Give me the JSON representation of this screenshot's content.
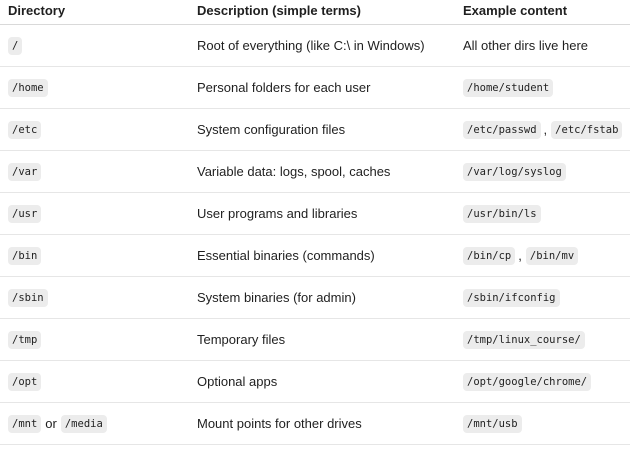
{
  "headers": {
    "directory": "Directory",
    "description": "Description (simple terms)",
    "example": "Example content"
  },
  "rows": [
    {
      "dirs": [
        "/"
      ],
      "dir_sep": "",
      "description": "Root of everything (like C:\\ in Windows)",
      "example_text": "All other dirs live here",
      "examples": []
    },
    {
      "dirs": [
        "/home"
      ],
      "dir_sep": "",
      "description": "Personal folders for each user",
      "example_text": "",
      "examples": [
        "/home/student"
      ]
    },
    {
      "dirs": [
        "/etc"
      ],
      "dir_sep": "",
      "description": "System configuration files",
      "example_text": "",
      "examples": [
        "/etc/passwd",
        "/etc/fstab"
      ]
    },
    {
      "dirs": [
        "/var"
      ],
      "dir_sep": "",
      "description": "Variable data: logs, spool, caches",
      "example_text": "",
      "examples": [
        "/var/log/syslog"
      ]
    },
    {
      "dirs": [
        "/usr"
      ],
      "dir_sep": "",
      "description": "User programs and libraries",
      "example_text": "",
      "examples": [
        "/usr/bin/ls"
      ]
    },
    {
      "dirs": [
        "/bin"
      ],
      "dir_sep": "",
      "description": "Essential binaries (commands)",
      "example_text": "",
      "examples": [
        "/bin/cp",
        "/bin/mv"
      ]
    },
    {
      "dirs": [
        "/sbin"
      ],
      "dir_sep": "",
      "description": "System binaries (for admin)",
      "example_text": "",
      "examples": [
        "/sbin/ifconfig"
      ]
    },
    {
      "dirs": [
        "/tmp"
      ],
      "dir_sep": "",
      "description": "Temporary files",
      "example_text": "",
      "examples": [
        "/tmp/linux_course/"
      ]
    },
    {
      "dirs": [
        "/opt"
      ],
      "dir_sep": "",
      "description": "Optional apps",
      "example_text": "",
      "examples": [
        "/opt/google/chrome/"
      ]
    },
    {
      "dirs": [
        "/mnt",
        "/media"
      ],
      "dir_sep": "or",
      "description": "Mount points for other drives",
      "example_text": "",
      "examples": [
        "/mnt/usb"
      ]
    }
  ],
  "example_separator": ","
}
